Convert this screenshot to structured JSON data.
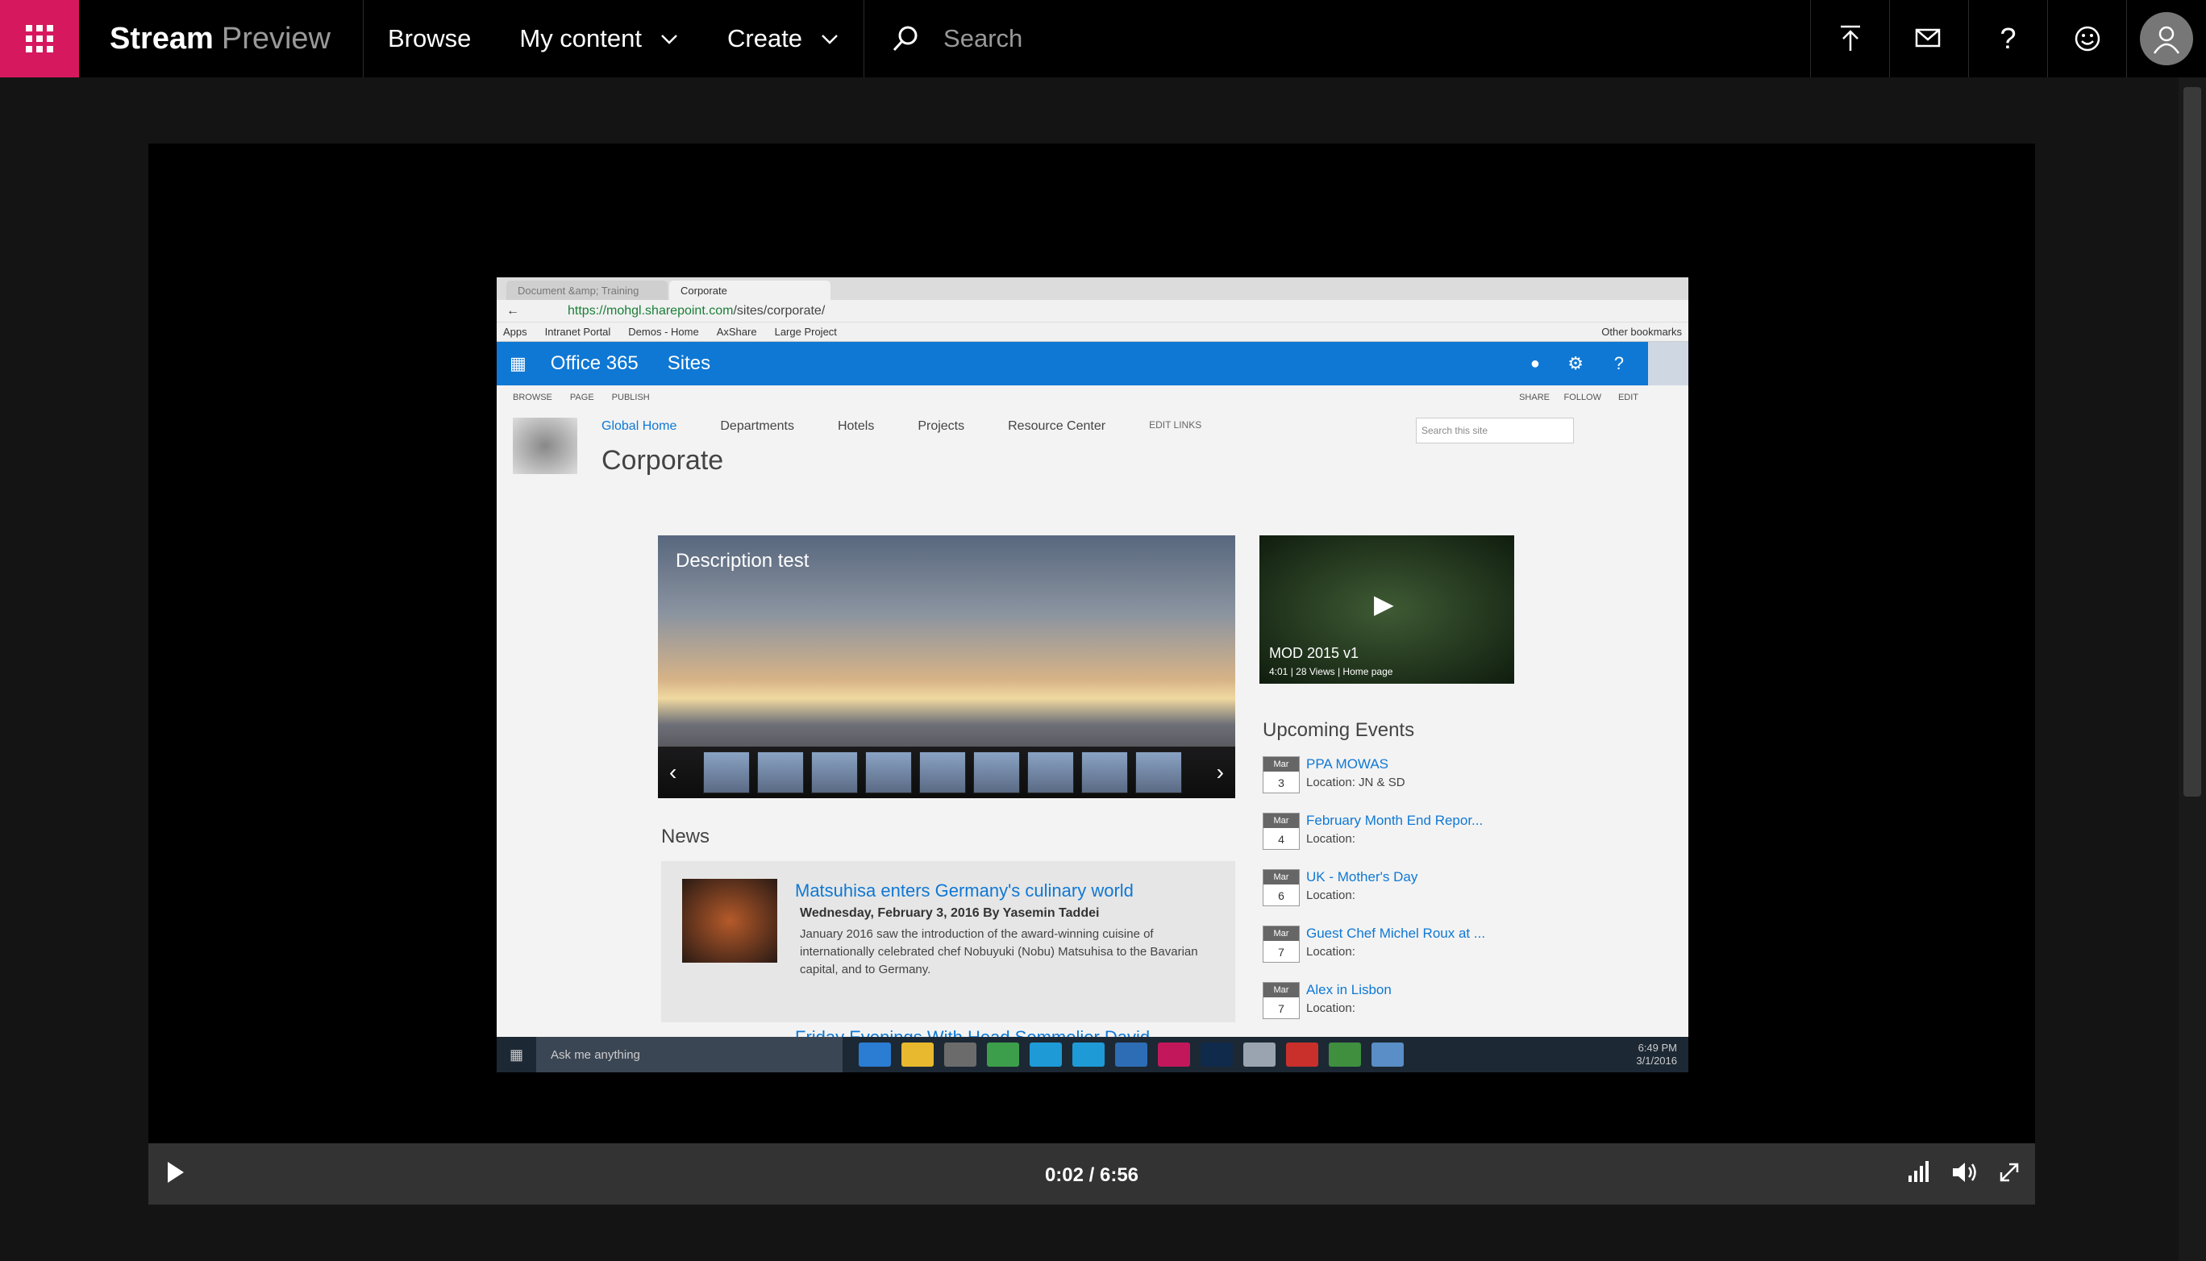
{
  "header": {
    "brand": "Stream",
    "brand_suffix": "Preview",
    "nav": [
      {
        "label": "Browse"
      },
      {
        "label": "My content"
      },
      {
        "label": "Create"
      }
    ],
    "search_placeholder": "Search",
    "accent": "#d6195f"
  },
  "player": {
    "time": "0:02 / 6:56",
    "progress": 0.005
  },
  "recorded_screen": {
    "tabs": [
      "Document &amp; Training",
      "Corporate"
    ],
    "url_host": "https://mohgl.sharepoint.com",
    "url_path": "/sites/corporate/",
    "bookmarks": [
      "Apps",
      "Intranet Portal",
      "Demos - Home",
      "AxShare",
      "Large Project"
    ],
    "other_bookmarks": "Other bookmarks",
    "suite_title": "Office 365",
    "suite_sites": "Sites",
    "ribbon": [
      "BROWSE",
      "PAGE",
      "PUBLISH"
    ],
    "ribbon_right": [
      "SHARE",
      "FOLLOW",
      "EDIT"
    ],
    "site_nav": [
      "Global Home",
      "Departments",
      "Hotels",
      "Projects",
      "Resource Center"
    ],
    "edit_links": "EDIT LINKS",
    "site_title": "Corporate",
    "site_search_placeholder": "Search this site",
    "hero_caption": "Description test",
    "video_title": "MOD 2015 v1",
    "video_meta": "4:01  |  28 Views  |  Home page",
    "events_header": "Upcoming Events",
    "events": [
      {
        "month": "Mar",
        "day": "3",
        "name": "PPA MOWAS",
        "location": "Location: JN & SD"
      },
      {
        "month": "Mar",
        "day": "4",
        "name": "February Month End Repor...",
        "location": "Location:"
      },
      {
        "month": "Mar",
        "day": "6",
        "name": "UK - Mother's Day",
        "location": "Location:"
      },
      {
        "month": "Mar",
        "day": "7",
        "name": "Guest Chef Michel Roux at ...",
        "location": "Location:"
      },
      {
        "month": "Mar",
        "day": "7",
        "name": "Alex in Lisbon",
        "location": "Location:"
      }
    ],
    "news_header": "News",
    "news_title": "Matsuhisa enters Germany's culinary world",
    "news_meta": "Wednesday, February 3, 2016     By Yasemin Taddei",
    "news_body": "January 2016 saw the introduction of the award-winning cuisine of internationally celebrated chef Nobuyuki (Nobu) Matsuhisa to the Bavarian capital, and to Germany.",
    "news2_title": "Friday Evenings With Head Sommelier David",
    "taskbar_search": "Ask me anything",
    "clock_time": "6:49 PM",
    "clock_date": "3/1/2016"
  }
}
